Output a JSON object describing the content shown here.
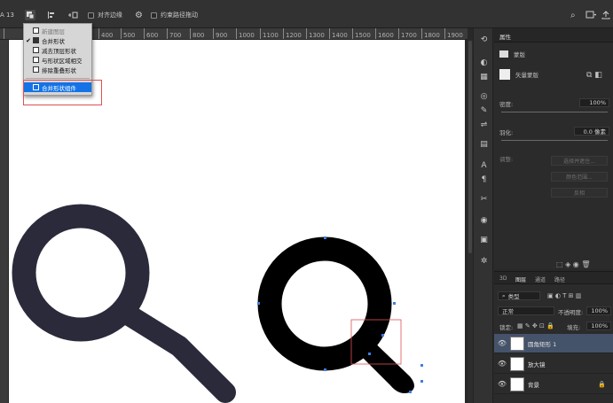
{
  "options_bar": {
    "left_label": "A 13",
    "align_edges_label": "对齐边缘",
    "constrain_path_label": "约束路径拖动"
  },
  "ruler": {
    "ticks": [
      "400",
      "500",
      "600",
      "700",
      "800",
      "900",
      "1000",
      "1100",
      "1200",
      "1300",
      "1400",
      "1500",
      "1600",
      "1700",
      "1800",
      "1900"
    ]
  },
  "menu": {
    "items": [
      {
        "label": "新建图层",
        "checked": false,
        "disabled": true
      },
      {
        "label": "合并形状",
        "checked": true,
        "disabled": false
      },
      {
        "label": "减去顶层形状",
        "checked": false,
        "disabled": false
      },
      {
        "label": "与形状区域相交",
        "checked": false,
        "disabled": false
      },
      {
        "label": "排除重叠形状",
        "checked": false,
        "disabled": false
      }
    ],
    "merge_components_label": "合并形状组件"
  },
  "properties": {
    "tab": "属性",
    "section": "蒙版",
    "sub": "矢量蒙版",
    "density_label": "密度:",
    "density_value": "100%",
    "feather_label": "羽化:",
    "feather_value": "0.0 像素",
    "adjust_label": "调整:",
    "btn_select_mask": "选择并遮住...",
    "btn_color_range": "颜色范围...",
    "btn_invert": "反相"
  },
  "layers": {
    "tabs": [
      "3D",
      "图层",
      "通道",
      "路径"
    ],
    "filter_label": "类型",
    "blend_mode": "正常",
    "opacity_label": "不透明度:",
    "opacity_value": "100%",
    "lock_label": "锁定:",
    "fill_label": "填充:",
    "fill_value": "100%",
    "items": [
      {
        "name": "圆角矩形 1",
        "selected": true,
        "lock": false
      },
      {
        "name": "放大镜",
        "selected": false,
        "lock": false
      },
      {
        "name": "背景",
        "selected": false,
        "lock": true
      }
    ]
  },
  "colors": {
    "icon_left": "#2b2a3a",
    "icon_right": "#000000",
    "anchor": "#3d7fe0",
    "highlight_red": "#e05050",
    "menu_active": "#1473e6",
    "layer_selected": "#45536a"
  }
}
